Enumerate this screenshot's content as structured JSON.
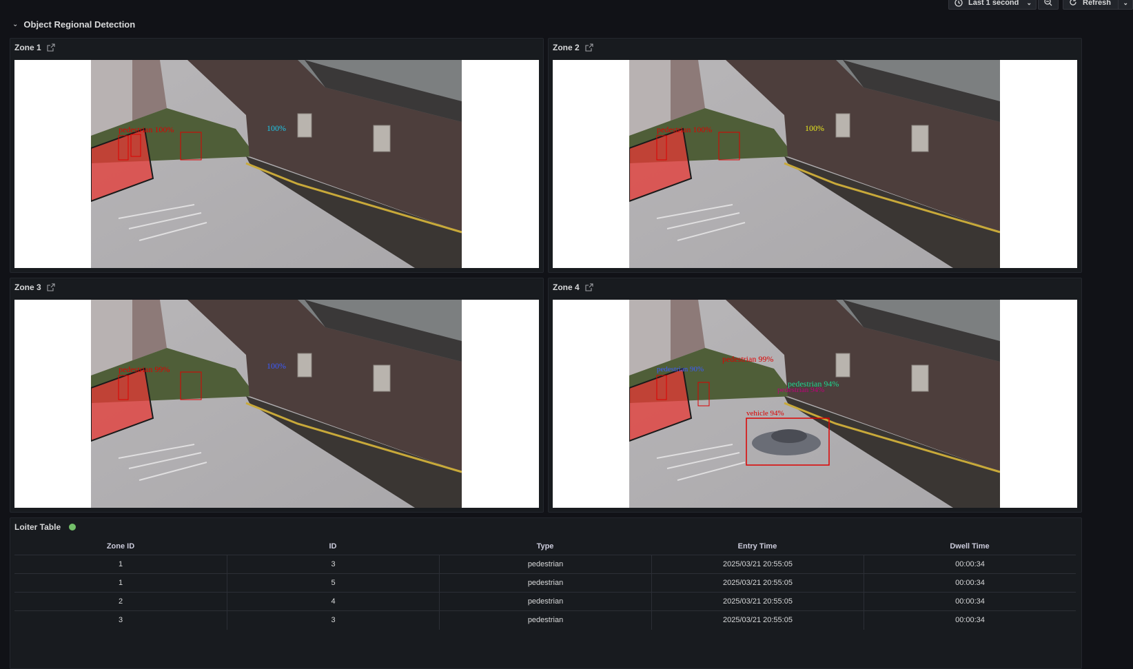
{
  "toolbar": {
    "time_range_label": "Last 1 second",
    "refresh_label": "Refresh"
  },
  "row": {
    "title": "Object Regional Detection"
  },
  "panels": [
    {
      "title": "Zone 1"
    },
    {
      "title": "Zone 2"
    },
    {
      "title": "Zone 3"
    },
    {
      "title": "Zone 4"
    }
  ],
  "detections": {
    "zone1": [
      "pedestrian 100%",
      "100%"
    ],
    "zone2": [
      "pedestrian 100%",
      "100%"
    ],
    "zone3": [
      "pedestrian 99%",
      "100%"
    ],
    "zone4": [
      "pedestrian 90%",
      "pedestrian 99%",
      "pedestrian 94%",
      "vehicle 94%",
      "pedestrian 94%"
    ]
  },
  "loiter_table": {
    "title": "Loiter Table",
    "status_color": "#73bf69",
    "columns": [
      "Zone ID",
      "ID",
      "Type",
      "Entry Time",
      "Dwell Time"
    ],
    "rows": [
      [
        "1",
        "3",
        "pedestrian",
        "2025/03/21 20:55:05",
        "00:00:34"
      ],
      [
        "1",
        "5",
        "pedestrian",
        "2025/03/21 20:55:05",
        "00:00:34"
      ],
      [
        "2",
        "4",
        "pedestrian",
        "2025/03/21 20:55:05",
        "00:00:34"
      ],
      [
        "3",
        "3",
        "pedestrian",
        "2025/03/21 20:55:05",
        "00:00:34"
      ]
    ]
  },
  "icons": {
    "clock": "clock-icon",
    "chevron": "chevron-down-icon",
    "zoom": "zoom-out-icon",
    "refresh": "refresh-icon",
    "external": "external-link-icon"
  }
}
